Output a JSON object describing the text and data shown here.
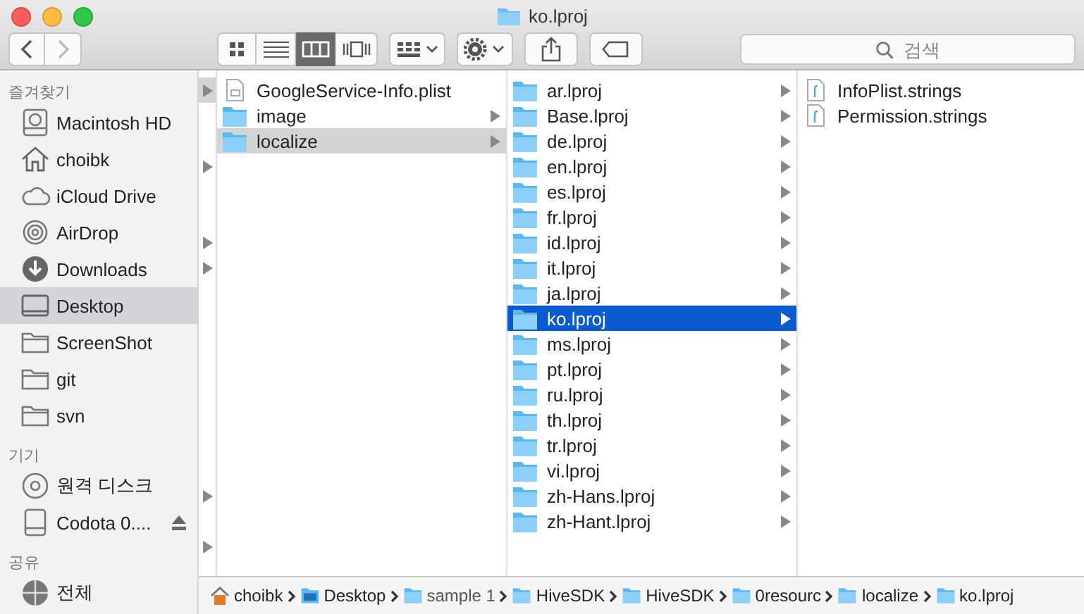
{
  "window": {
    "title": "ko.lproj"
  },
  "toolbar": {
    "back_disabled": false,
    "forward_disabled": true,
    "view_modes": [
      {
        "kind": "icons",
        "selected": false
      },
      {
        "kind": "list",
        "selected": false
      },
      {
        "kind": "columns",
        "selected": true
      },
      {
        "kind": "coverflow",
        "selected": false
      }
    ],
    "search": {
      "placeholder": "검색"
    }
  },
  "sidebar": {
    "sections": [
      {
        "title": "즐겨찾기",
        "items": [
          {
            "label": "Macintosh HD",
            "kind": "disk",
            "selected": false
          },
          {
            "label": "choibk",
            "kind": "home",
            "selected": false
          },
          {
            "label": "iCloud Drive",
            "kind": "cloud",
            "selected": false
          },
          {
            "label": "AirDrop",
            "kind": "airdrop",
            "selected": false
          },
          {
            "label": "Downloads",
            "kind": "download",
            "selected": false
          },
          {
            "label": "Desktop",
            "kind": "desktop",
            "selected": true
          },
          {
            "label": "ScreenShot",
            "kind": "folder",
            "selected": false
          },
          {
            "label": "git",
            "kind": "folder",
            "selected": false
          },
          {
            "label": "svn",
            "kind": "folder",
            "selected": false
          }
        ]
      },
      {
        "title": "기기",
        "items": [
          {
            "label": "원격 디스크",
            "kind": "disc",
            "selected": false
          },
          {
            "label": "Codota 0....",
            "kind": "drive",
            "selected": false,
            "ejectable": true
          }
        ]
      },
      {
        "title": "공유",
        "items": [
          {
            "label": "전체",
            "kind": "network",
            "selected": false
          }
        ]
      }
    ]
  },
  "narrow_column": {
    "rows": [
      {
        "has_children": true,
        "selected": true
      },
      {
        "has_children": false,
        "selected": false
      },
      {
        "has_children": false,
        "selected": false
      },
      {
        "has_children": true,
        "selected": false
      },
      {
        "has_children": false,
        "selected": false
      },
      {
        "has_children": false,
        "selected": false
      },
      {
        "has_children": true,
        "selected": false
      },
      {
        "has_children": true,
        "selected": false
      },
      {
        "has_children": false,
        "selected": false
      },
      {
        "has_children": false,
        "selected": false
      },
      {
        "has_children": false,
        "selected": false
      },
      {
        "has_children": false,
        "selected": false
      },
      {
        "has_children": false,
        "selected": false
      },
      {
        "has_children": false,
        "selected": false
      },
      {
        "has_children": false,
        "selected": false
      },
      {
        "has_children": false,
        "selected": false
      },
      {
        "has_children": true,
        "selected": false
      },
      {
        "has_children": false,
        "selected": false
      },
      {
        "has_children": true,
        "selected": false
      }
    ]
  },
  "columns": [
    {
      "active": false,
      "items": [
        {
          "name": "GoogleService-Info.plist",
          "kind": "plist",
          "has_children": false,
          "selected": false
        },
        {
          "name": "image",
          "kind": "folder",
          "has_children": true,
          "selected": false
        },
        {
          "name": "localize",
          "kind": "folder",
          "has_children": true,
          "selected": true
        }
      ]
    },
    {
      "active": true,
      "items": [
        {
          "name": "ar.lproj",
          "kind": "folder",
          "has_children": true,
          "selected": false
        },
        {
          "name": "Base.lproj",
          "kind": "folder",
          "has_children": true,
          "selected": false
        },
        {
          "name": "de.lproj",
          "kind": "folder",
          "has_children": true,
          "selected": false
        },
        {
          "name": "en.lproj",
          "kind": "folder",
          "has_children": true,
          "selected": false
        },
        {
          "name": "es.lproj",
          "kind": "folder",
          "has_children": true,
          "selected": false
        },
        {
          "name": "fr.lproj",
          "kind": "folder",
          "has_children": true,
          "selected": false
        },
        {
          "name": "id.lproj",
          "kind": "folder",
          "has_children": true,
          "selected": false
        },
        {
          "name": "it.lproj",
          "kind": "folder",
          "has_children": true,
          "selected": false
        },
        {
          "name": "ja.lproj",
          "kind": "folder",
          "has_children": true,
          "selected": false
        },
        {
          "name": "ko.lproj",
          "kind": "folder",
          "has_children": true,
          "selected": true
        },
        {
          "name": "ms.lproj",
          "kind": "folder",
          "has_children": true,
          "selected": false
        },
        {
          "name": "pt.lproj",
          "kind": "folder",
          "has_children": true,
          "selected": false
        },
        {
          "name": "ru.lproj",
          "kind": "folder",
          "has_children": true,
          "selected": false
        },
        {
          "name": "th.lproj",
          "kind": "folder",
          "has_children": true,
          "selected": false
        },
        {
          "name": "tr.lproj",
          "kind": "folder",
          "has_children": true,
          "selected": false
        },
        {
          "name": "vi.lproj",
          "kind": "folder",
          "has_children": true,
          "selected": false
        },
        {
          "name": "zh-Hans.lproj",
          "kind": "folder",
          "has_children": true,
          "selected": false
        },
        {
          "name": "zh-Hant.lproj",
          "kind": "folder",
          "has_children": true,
          "selected": false
        }
      ]
    },
    {
      "items": [
        {
          "name": "InfoPlist.strings",
          "kind": "strings",
          "has_children": false,
          "selected": false
        },
        {
          "name": "Permission.strings",
          "kind": "strings",
          "has_children": false,
          "selected": false
        }
      ]
    }
  ],
  "path_bar": [
    {
      "label": "choibk",
      "kind": "home"
    },
    {
      "label": "Desktop",
      "kind": "desktop"
    },
    {
      "label": "sample 1",
      "kind": "folder"
    },
    {
      "label": "HiveSDK",
      "kind": "folder"
    },
    {
      "label": "HiveSDK",
      "kind": "folder"
    },
    {
      "label": "0resourc",
      "kind": "folder"
    },
    {
      "label": "localize",
      "kind": "folder"
    },
    {
      "label": "ko.lproj",
      "kind": "folder"
    }
  ]
}
